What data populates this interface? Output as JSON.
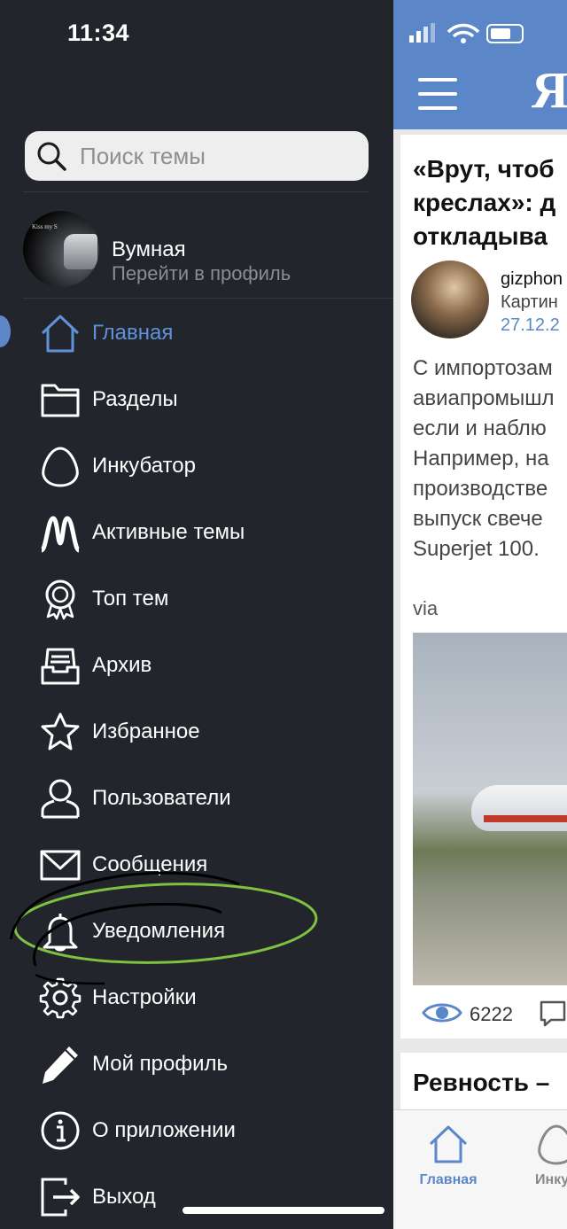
{
  "status_bar": {
    "time": "11:34"
  },
  "drawer": {
    "search": {
      "placeholder": "Поиск темы"
    },
    "profile": {
      "name": "Вумная",
      "subtitle": "Перейти в профиль",
      "avatar_text": "Kiss my S"
    },
    "menu": [
      {
        "label": "Главная",
        "icon": "home-icon",
        "active": true
      },
      {
        "label": "Разделы",
        "icon": "folder-icon"
      },
      {
        "label": "Инкубатор",
        "icon": "egg-icon"
      },
      {
        "label": "Активные темы",
        "icon": "activity-icon"
      },
      {
        "label": "Топ тем",
        "icon": "award-icon"
      },
      {
        "label": "Архив",
        "icon": "archive-icon"
      },
      {
        "label": "Избранное",
        "icon": "star-icon"
      },
      {
        "label": "Пользователи",
        "icon": "user-icon"
      },
      {
        "label": "Сообщения",
        "icon": "mail-icon"
      },
      {
        "label": "Уведомления",
        "icon": "bell-icon"
      },
      {
        "label": "Настройки",
        "icon": "gear-icon"
      },
      {
        "label": "Мой профиль",
        "icon": "pencil-icon"
      },
      {
        "label": "О приложении",
        "icon": "info-icon"
      },
      {
        "label": "Выход",
        "icon": "logout-icon"
      }
    ]
  },
  "feed": {
    "logo": "Я",
    "article": {
      "title_lines": [
        "«Врут, чтоб",
        "креслах»: д",
        "откладыва"
      ],
      "author": "gizphon",
      "category": "Картин",
      "date": "27.12.2",
      "body_lines": [
        "С импортозам",
        "авиапромышл",
        "если и наблю",
        "Например, на",
        "производстве",
        "выпуск свече",
        "Superjet 100."
      ],
      "via": "via",
      "views": "6222"
    },
    "next_article_title": "Ревность –",
    "tabs": [
      {
        "label": "Главная",
        "icon": "home-icon",
        "active": true
      },
      {
        "label": "Инкуб",
        "icon": "egg-icon"
      }
    ]
  },
  "colors": {
    "accent": "#5b87c9",
    "drawer_bg": "#22252b",
    "highlight_circle": "#7fc241"
  }
}
